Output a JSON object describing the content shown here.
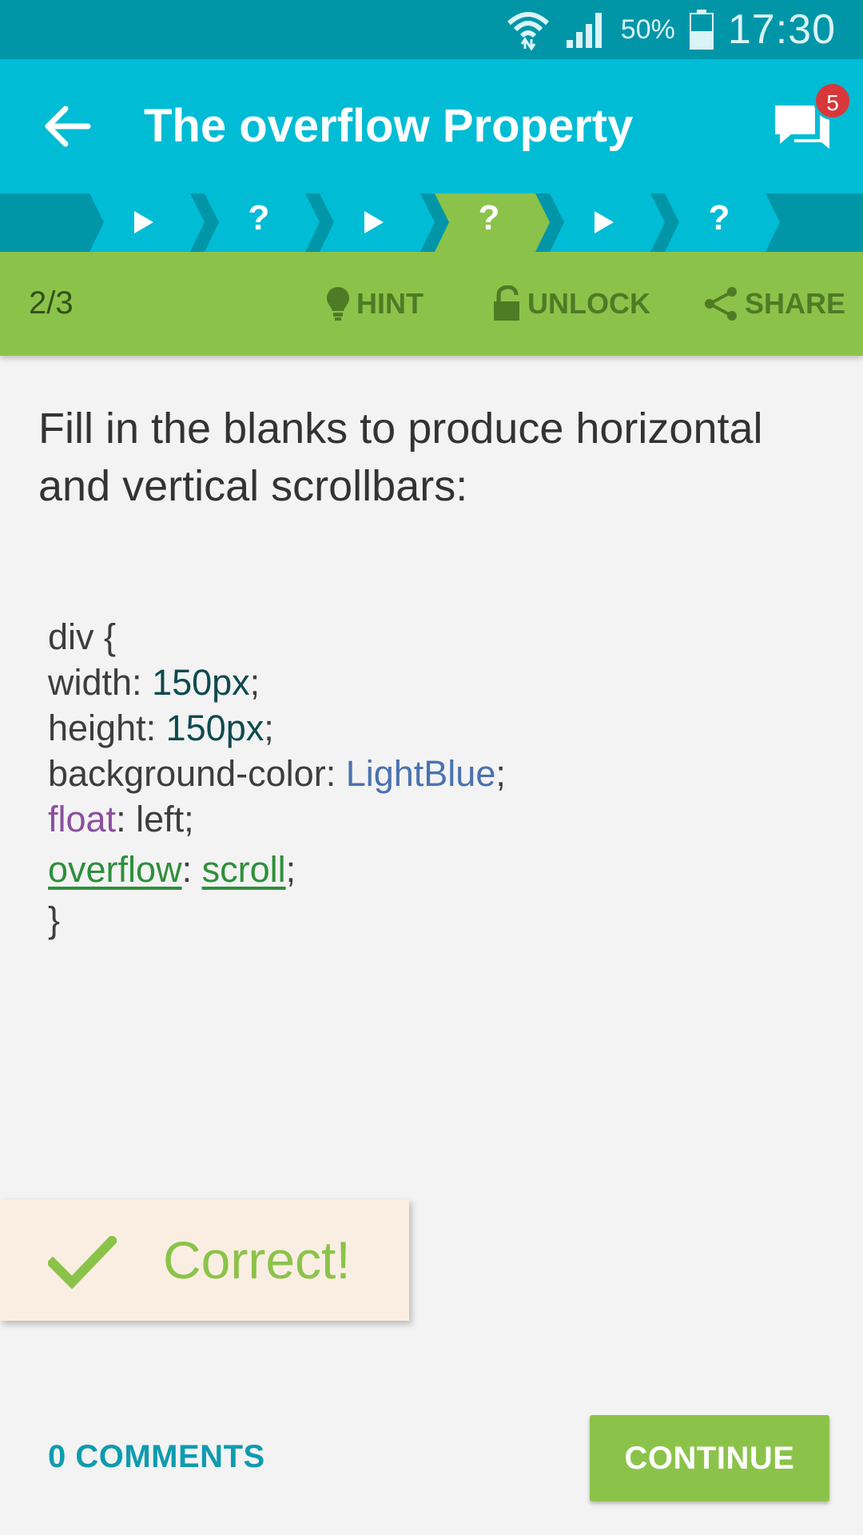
{
  "status_bar": {
    "battery_percent": "50%",
    "time": "17:30",
    "icons": [
      "wifi-icon",
      "signal-icon",
      "battery-icon"
    ]
  },
  "app_bar": {
    "title": "The overflow Property",
    "notification_count": "5",
    "icons": [
      "back-arrow-icon",
      "chat-icon"
    ]
  },
  "progress": {
    "steps": [
      {
        "type": "play",
        "label": ""
      },
      {
        "type": "quiz",
        "label": "?"
      },
      {
        "type": "play",
        "label": ""
      },
      {
        "type": "quiz",
        "label": "?",
        "active": true
      },
      {
        "type": "play",
        "label": ""
      },
      {
        "type": "quiz",
        "label": "?"
      }
    ]
  },
  "toolbar": {
    "counter": "2/3",
    "hint_label": "HINT",
    "unlock_label": "UNLOCK",
    "share_label": "SHARE"
  },
  "question": {
    "text": "Fill in the blanks to produce horizontal and vertical scrollbars:"
  },
  "code": {
    "line1": "div {",
    "width_prop": "width: ",
    "width_val": "150px",
    "height_prop": "height: ",
    "height_val": "150px",
    "bg_prop": "background-color: ",
    "bg_val": "LightBlue",
    "float_prop": "float",
    "float_rest": ": left;",
    "blank1": "overflow",
    "sep": ": ",
    "blank2": "scroll",
    "semicolon": ";",
    "closing": "}"
  },
  "feedback": {
    "text": "Correct!"
  },
  "footer": {
    "comments_label": "0 COMMENTS",
    "continue_label": "CONTINUE"
  },
  "colors": {
    "status_bar": "#0096a8",
    "app_bar": "#00bcd4",
    "accent_green": "#8bc34a",
    "badge_red": "#d9383a"
  }
}
